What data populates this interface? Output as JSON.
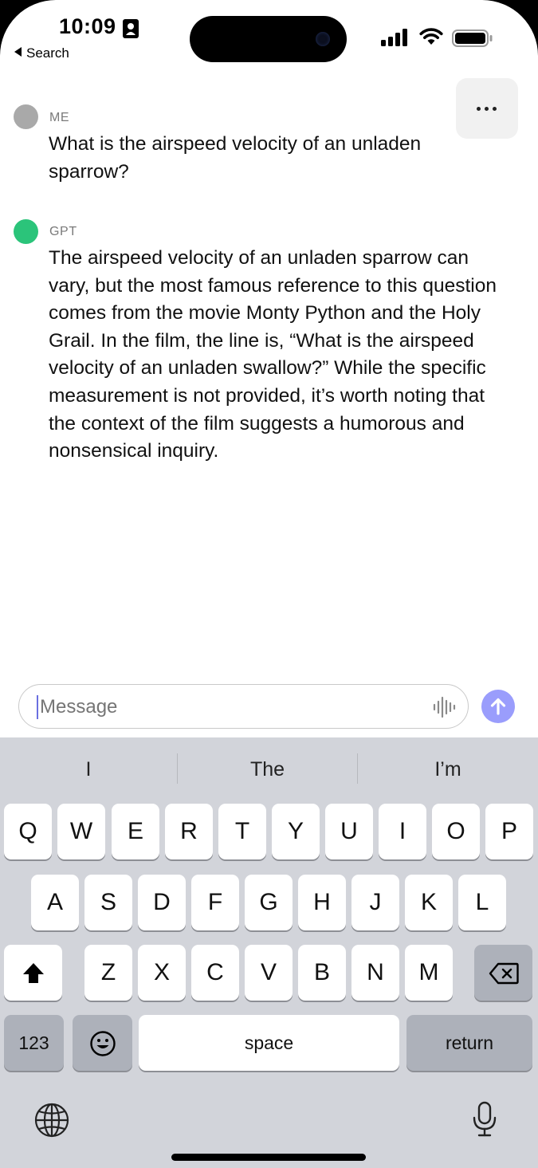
{
  "status_bar": {
    "time": "10:09",
    "back_label": "Search"
  },
  "conversation": {
    "messages": [
      {
        "sender": "ME",
        "avatar_color": "#a9a9a9",
        "text": "What is the airspeed velocity of an unladen sparrow?"
      },
      {
        "sender": "GPT",
        "avatar_color": "#2bc47a",
        "text": "The airspeed velocity of an unladen sparrow can vary, but the most famous reference to this question comes from the movie Monty Python and the Holy Grail. In the film, the line is, “What is the airspeed velocity of an unladen swallow?” While the specific measurement is not provided, it’s worth noting that the context of the film suggests a humorous and nonsensical inquiry."
      }
    ]
  },
  "composer": {
    "placeholder": "Message",
    "value": "",
    "send_color": "#9a9dfc"
  },
  "keyboard": {
    "suggestions": [
      "I",
      "The",
      "I’m"
    ],
    "row1": [
      "Q",
      "W",
      "E",
      "R",
      "T",
      "Y",
      "U",
      "I",
      "O",
      "P"
    ],
    "row2": [
      "A",
      "S",
      "D",
      "F",
      "G",
      "H",
      "J",
      "K",
      "L"
    ],
    "row3": [
      "Z",
      "X",
      "C",
      "V",
      "B",
      "N",
      "M"
    ],
    "numbers_label": "123",
    "space_label": "space",
    "return_label": "return"
  }
}
